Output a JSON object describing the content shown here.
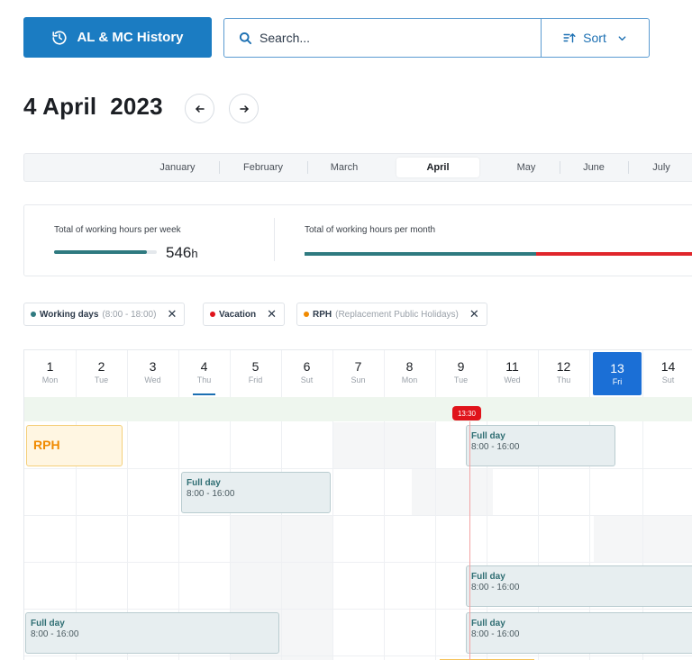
{
  "toolbar": {
    "history_label": "AL & MC History",
    "search_placeholder": "Search...",
    "sort_label": "Sort"
  },
  "header": {
    "date_title": "4 April  2023"
  },
  "months": [
    "January",
    "February",
    "March",
    "April",
    "May",
    "June",
    "July"
  ],
  "active_month": "April",
  "stats": {
    "week_label": "Total of working hours per week",
    "week_value": "546",
    "week_unit": "h",
    "week_progress": 0.9,
    "month_label": "Total of working hours per month",
    "month_progress_teal": 0.57
  },
  "legend": [
    {
      "label": "Working days",
      "detail": "(8:00 - 18:00)",
      "color": "#2f7a80"
    },
    {
      "label": "Vacation",
      "detail": "",
      "color": "#e0141b"
    },
    {
      "label": "RPH",
      "detail": "(Replacement Public Holidays)",
      "color": "#f08a00"
    }
  ],
  "days": [
    {
      "num": "1",
      "dow": "Mon"
    },
    {
      "num": "2",
      "dow": "Tue"
    },
    {
      "num": "3",
      "dow": "Wed"
    },
    {
      "num": "4",
      "dow": "Thu"
    },
    {
      "num": "5",
      "dow": "Frid"
    },
    {
      "num": "6",
      "dow": "Sut"
    },
    {
      "num": "7",
      "dow": "Sun"
    },
    {
      "num": "8",
      "dow": "Mon"
    },
    {
      "num": "9",
      "dow": "Tue"
    },
    {
      "num": "11",
      "dow": "Wed"
    },
    {
      "num": "12",
      "dow": "Thu"
    },
    {
      "num": "13",
      "dow": "Fri"
    },
    {
      "num": "14",
      "dow": "Sut"
    }
  ],
  "now_time": "13:30",
  "rph_label": "RPH",
  "events": [
    {
      "title": "Full day",
      "time": "8:00 - 16:00"
    },
    {
      "title": "Full day",
      "time": "8:00 - 16:00"
    },
    {
      "title": "Full day",
      "time": "8:00 - 16:00"
    },
    {
      "title": "Full day",
      "time": "8:00 - 16:00"
    },
    {
      "title": "Full day",
      "time": "8:00 - 16:00"
    }
  ]
}
